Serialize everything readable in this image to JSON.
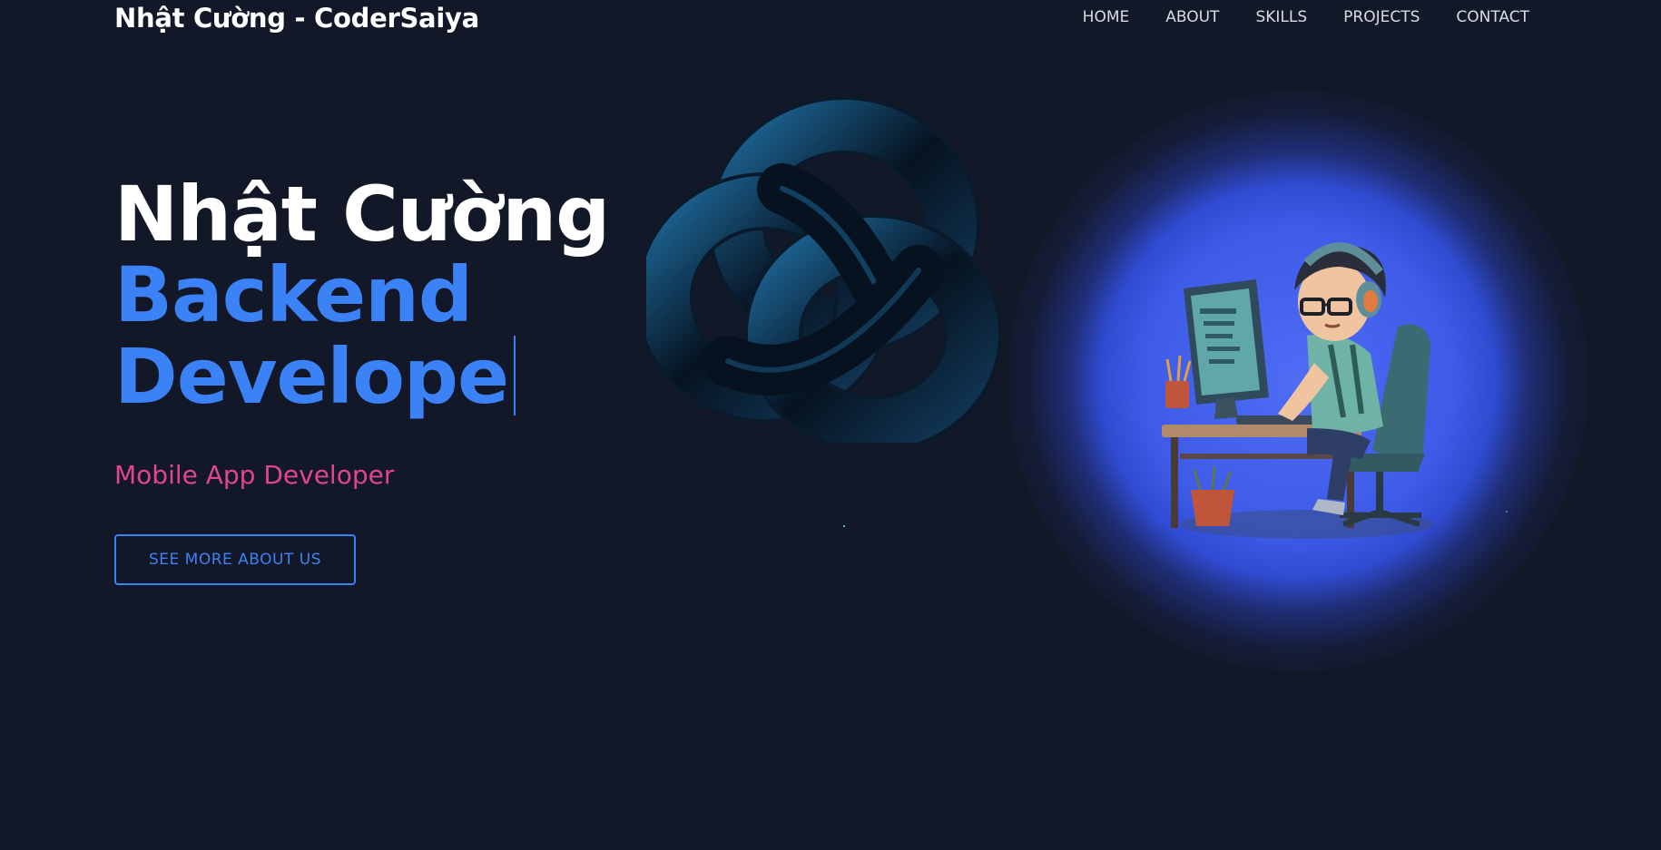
{
  "header": {
    "brand": "Nhật Cường - CoderSaiya",
    "nav": [
      "HOME",
      "ABOUT",
      "SKILLS",
      "PROJECTS",
      "CONTACT"
    ]
  },
  "hero": {
    "name": "Nhật Cường",
    "role_line1": "Backend",
    "role_line2": "Develope",
    "subtitle": "Mobile App Developer",
    "cta": "SEE MORE ABOUT US"
  },
  "colors": {
    "background": "#121828",
    "accent": "#3b82f6",
    "subtitle": "#e0458f"
  },
  "icons": [
    "trefoil-knot-3d",
    "developer-avatar"
  ]
}
